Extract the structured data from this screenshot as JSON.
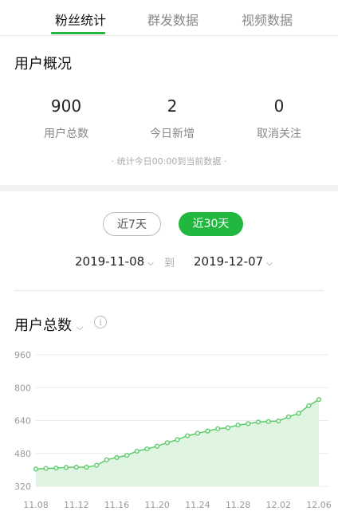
{
  "tabs": [
    {
      "label": "粉丝统计",
      "active": true
    },
    {
      "label": "群发数据",
      "active": false
    },
    {
      "label": "视频数据",
      "active": false
    }
  ],
  "overview": {
    "title": "用户概况",
    "stats": [
      {
        "value": "900",
        "label": "用户总数"
      },
      {
        "value": "2",
        "label": "今日新增"
      },
      {
        "value": "0",
        "label": "取消关注"
      }
    ],
    "note": "· 统计今日00:00到当前数据 ·"
  },
  "range": {
    "options": [
      {
        "label": "近7天",
        "selected": false
      },
      {
        "label": "近30天",
        "selected": true
      }
    ],
    "start_date": "2019-11-08",
    "separator": "到",
    "end_date": "2019-12-07"
  },
  "metric": {
    "title": "用户总数",
    "info_icon": "info-icon",
    "dropdown_icon": "chevron-down-icon"
  },
  "colors": {
    "accent": "#22b83f",
    "line": "#5ccc69",
    "fill": "#dff5e2"
  },
  "chart_data": {
    "type": "area",
    "title": "",
    "xlabel": "",
    "ylabel": "",
    "ylim": [
      320,
      960
    ],
    "yticks": [
      960,
      800,
      640,
      480,
      320
    ],
    "xtick_labels": [
      "11.08",
      "11.12",
      "11.16",
      "11.20",
      "11.24",
      "11.28",
      "12.02",
      "12.06"
    ],
    "x": [
      "11.08",
      "11.09",
      "11.10",
      "11.11",
      "11.12",
      "11.13",
      "11.14",
      "11.15",
      "11.16",
      "11.17",
      "11.18",
      "11.19",
      "11.20",
      "11.21",
      "11.22",
      "11.23",
      "11.24",
      "11.25",
      "11.26",
      "11.27",
      "11.28",
      "11.29",
      "11.30",
      "12.01",
      "12.02",
      "12.03",
      "12.04",
      "12.05",
      "12.06"
    ],
    "series": [
      {
        "values": [
          404,
          407,
          409,
          412,
          413,
          413,
          422,
          449,
          460,
          471,
          491,
          502,
          515,
          532,
          547,
          566,
          578,
          589,
          600,
          605,
          618,
          625,
          633,
          635,
          638,
          658,
          675,
          712,
          742
        ]
      }
    ],
    "grid": true,
    "legend": "none"
  }
}
